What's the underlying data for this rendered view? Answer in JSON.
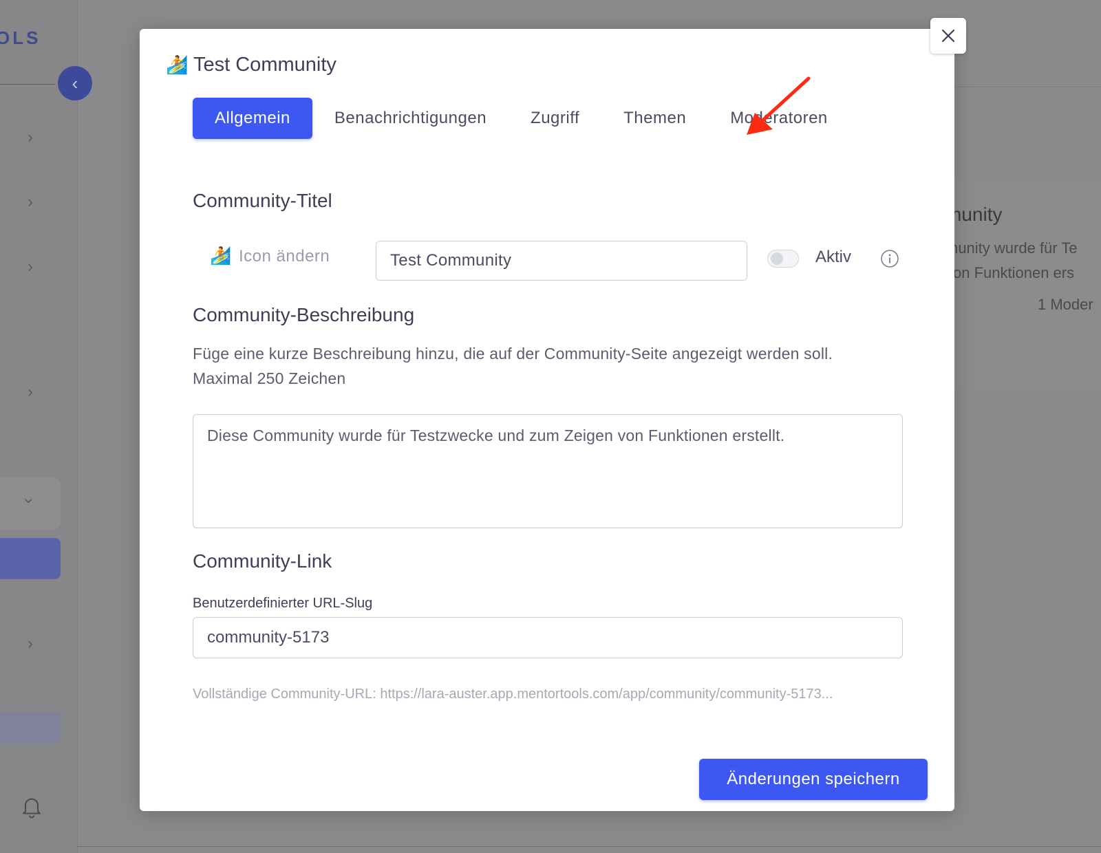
{
  "background": {
    "brand_fragment": "OLS",
    "card_title_fragment": "munity",
    "card_text_line1": "munity wurde für Te",
    "card_text_line2": "von Funktionen ers",
    "card_text_line3": "1 Moder"
  },
  "modal": {
    "title_emoji": "🏄",
    "title": "Test Community",
    "tabs": [
      {
        "label": "Allgemein",
        "active": true
      },
      {
        "label": "Benachrichtigungen",
        "active": false
      },
      {
        "label": "Zugriff",
        "active": false
      },
      {
        "label": "Themen",
        "active": false
      },
      {
        "label": "Moderatoren",
        "active": false
      }
    ],
    "title_section": {
      "heading": "Community-Titel",
      "icon_emoji": "🏄",
      "icon_change_label": "Icon ändern",
      "title_value": "Test Community",
      "active_label": "Aktiv",
      "active": false
    },
    "description_section": {
      "heading": "Community-Beschreibung",
      "help_text": "Füge eine kurze Beschreibung hinzu, die auf der Community-Seite angezeigt werden soll. Maximal 250 Zeichen",
      "value": "Diese Community wurde für Testzwecke und zum Zeigen von Funktionen erstellt."
    },
    "link_section": {
      "heading": "Community-Link",
      "slug_label": "Benutzerdefinierter URL-Slug",
      "slug_value": "community-5173",
      "full_url_text": "Vollständige Community-URL: https://lara-auster.app.mentortools.com/app/community/community-5173..."
    },
    "save_button_label": "Änderungen speichern"
  },
  "colors": {
    "accent": "#3d57f2",
    "annotation_arrow": "#ff2a12",
    "overlay": "#8a8a8c"
  }
}
